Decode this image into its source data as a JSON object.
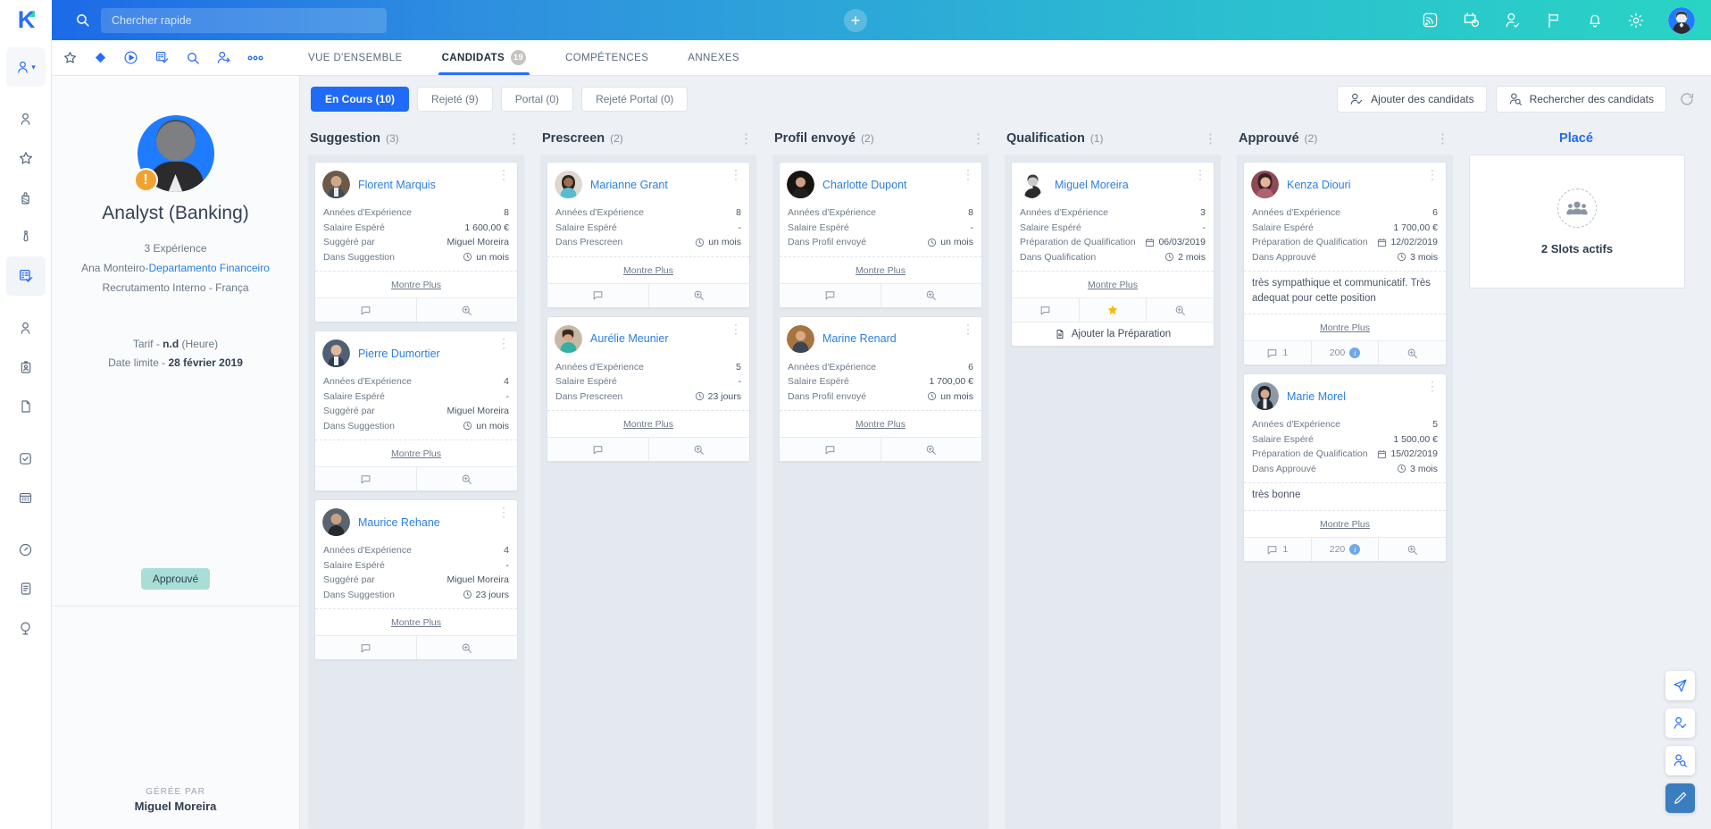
{
  "topbar": {
    "logo_text": "K",
    "search_placeholder": "Chercher rapide",
    "search_value": "",
    "add_label": "+",
    "icons": [
      "rss-feed-icon",
      "calendar-clock-icon",
      "person-add-icon",
      "flag-icon",
      "bell-icon",
      "gear-icon"
    ]
  },
  "rail": {
    "items": [
      {
        "name": "person-dropdown",
        "icon": "person-chevron-icon"
      },
      {
        "name": "person",
        "icon": "person-icon"
      },
      {
        "name": "favorites",
        "icon": "star-icon"
      },
      {
        "name": "briefcase",
        "icon": "briefcase-icon"
      },
      {
        "name": "tie",
        "icon": "tie-icon"
      },
      {
        "name": "jobs",
        "icon": "list-check-icon"
      },
      {
        "name": "contact",
        "icon": "person-outline-icon"
      },
      {
        "name": "badge",
        "icon": "id-badge-icon"
      },
      {
        "name": "documents",
        "icon": "document-icon"
      },
      {
        "name": "tasks",
        "icon": "check-square-icon"
      },
      {
        "name": "calendar",
        "icon": "calendar-grid-icon"
      },
      {
        "name": "reports",
        "icon": "gauge-icon"
      },
      {
        "name": "notes",
        "icon": "notes-icon"
      },
      {
        "name": "globe",
        "icon": "globe-icon"
      }
    ]
  },
  "tabbar": {
    "quick_icons": [
      "star-outline-icon",
      "diamond-icon",
      "play-circle-icon",
      "list-check-icon",
      "search-icon",
      "person-add-icon",
      "more-dots-icon"
    ],
    "tabs": [
      {
        "label": "VUE D'ENSEMBLE",
        "badge": "",
        "active": false
      },
      {
        "label": "CANDIDATS",
        "badge": "19",
        "active": true
      },
      {
        "label": "COMPÉTENCES",
        "badge": "",
        "active": false
      },
      {
        "label": "ANNEXES",
        "badge": "",
        "active": false
      }
    ]
  },
  "jobpanel": {
    "title": "Analyst (Banking)",
    "experience": "3 Expérience",
    "owner_prefix": "Ana Monteiro-",
    "department": "Departamento Financeiro",
    "recruitment": "Recrutamento Interno  -  França",
    "rate_label": "Tarif  -  ",
    "rate_value": "n.d",
    "rate_unit": "  (Heure)",
    "deadline_label": "Date limite  -  ",
    "deadline_value": "28 février 2019",
    "status": "Approuvé",
    "managed_by_label": "GÉRÉE PAR",
    "managed_by_name": "Miguel Moreira",
    "alert_icon": "warning-icon"
  },
  "toolbar": {
    "filters": [
      {
        "label": "En Cours (10)",
        "active": true
      },
      {
        "label": "Rejeté (9)",
        "active": false
      },
      {
        "label": "Portal (0)",
        "active": false
      },
      {
        "label": "Rejeté Portal (0)",
        "active": false
      }
    ],
    "add_candidates": "Ajouter des candidats",
    "search_candidates": "Rechercher des candidats",
    "refresh_icon": "refresh-icon"
  },
  "board": {
    "columns": [
      {
        "name": "Suggestion",
        "count": "(3)",
        "cards": [
          {
            "name": "Florent Marquis",
            "avatar_tone": "#6b5a4a",
            "rows": [
              {
                "label": "Années d'Expérience",
                "value": "8"
              },
              {
                "label": "Salaire Espéré",
                "value": "1 600,00 €"
              },
              {
                "label": "Suggéré par",
                "value": "Miguel Moreira"
              },
              {
                "label": "Dans Suggestion",
                "value": "un mois",
                "icon": "clock-icon"
              }
            ],
            "more": "Montre Plus",
            "actions": [
              "comment-icon",
              "zoom-search-icon"
            ]
          },
          {
            "name": "Pierre Dumortier",
            "avatar_tone": "#4f6074",
            "rows": [
              {
                "label": "Années d'Expérience",
                "value": "4"
              },
              {
                "label": "Salaire Espéré",
                "value": "-"
              },
              {
                "label": "Suggéré par",
                "value": "Miguel Moreira"
              },
              {
                "label": "Dans Suggestion",
                "value": "un mois",
                "icon": "clock-icon"
              }
            ],
            "more": "Montre Plus",
            "actions": [
              "comment-icon",
              "zoom-search-icon"
            ]
          },
          {
            "name": "Maurice Rehane",
            "avatar_tone": "#59646e",
            "rows": [
              {
                "label": "Années d'Expérience",
                "value": "4"
              },
              {
                "label": "Salaire Espéré",
                "value": "-"
              },
              {
                "label": "Suggéré par",
                "value": "Miguel Moreira"
              },
              {
                "label": "Dans Suggestion",
                "value": "23 jours",
                "icon": "clock-icon"
              }
            ],
            "more": "Montre Plus",
            "actions": [
              "comment-icon",
              "zoom-search-icon"
            ]
          }
        ]
      },
      {
        "name": "Prescreen",
        "count": "(2)",
        "cards": [
          {
            "name": "Marianne Grant",
            "avatar_tone": "#6d5143",
            "rows": [
              {
                "label": "Années d'Expérience",
                "value": "8"
              },
              {
                "label": "Salaire Espéré",
                "value": "-"
              },
              {
                "label": "Dans Prescreen",
                "value": "un mois",
                "icon": "clock-icon"
              }
            ],
            "more": "Montre Plus",
            "actions": [
              "comment-icon",
              "zoom-search-icon"
            ]
          },
          {
            "name": "Aurélie Meunier",
            "avatar_tone": "#3f9a9a",
            "rows": [
              {
                "label": "Années d'Expérience",
                "value": "5"
              },
              {
                "label": "Salaire Espéré",
                "value": "-"
              },
              {
                "label": "Dans Prescreen",
                "value": "23 jours",
                "icon": "clock-icon"
              }
            ],
            "more": "Montre Plus",
            "actions": [
              "comment-icon",
              "zoom-search-icon"
            ]
          }
        ]
      },
      {
        "name": "Profil envoyé",
        "count": "(2)",
        "cards": [
          {
            "name": "Charlotte Dupont",
            "avatar_tone": "#2f2a28",
            "rows": [
              {
                "label": "Années d'Expérience",
                "value": "8"
              },
              {
                "label": "Salaire Espéré",
                "value": "-"
              },
              {
                "label": "Dans Profil envoyé",
                "value": "un mois",
                "icon": "clock-icon"
              }
            ],
            "more": "Montre Plus",
            "actions": [
              "comment-icon",
              "zoom-search-icon"
            ]
          },
          {
            "name": "Marine Renard",
            "avatar_tone": "#8a6a48",
            "rows": [
              {
                "label": "Années d'Expérience",
                "value": "6"
              },
              {
                "label": "Salaire Espéré",
                "value": "1 700,00 €"
              },
              {
                "label": "Dans Profil envoyé",
                "value": "un mois",
                "icon": "clock-icon"
              }
            ],
            "more": "Montre Plus",
            "actions": [
              "comment-icon",
              "zoom-search-icon"
            ]
          }
        ]
      },
      {
        "name": "Qualification",
        "count": "(1)",
        "cards": [
          {
            "name": "Miguel Moreira",
            "avatar_tone": "#ffffff",
            "rows": [
              {
                "label": "Années d'Expérience",
                "value": "3"
              },
              {
                "label": "Salaire Espéré",
                "value": "-"
              },
              {
                "label": "Préparation de Qualification",
                "value": "06/03/2019",
                "icon": "calendar-icon"
              },
              {
                "label": "Dans Qualification",
                "value": "2 mois",
                "icon": "clock-icon"
              }
            ],
            "more": "Montre Plus",
            "actions": [
              "comment-icon",
              "star-icon",
              "zoom-search-icon"
            ],
            "footer_button": "Ajouter la Préparation",
            "footer_icon": "document-icon"
          }
        ]
      },
      {
        "name": "Approuvé",
        "count": "(2)",
        "cards": [
          {
            "name": "Kenza Diouri",
            "avatar_tone": "#a3606b",
            "rows": [
              {
                "label": "Années d'Expérience",
                "value": "6"
              },
              {
                "label": "Salaire Espéré",
                "value": "1 700,00 €"
              },
              {
                "label": "Préparation de Qualification",
                "value": "12/02/2019",
                "icon": "calendar-icon"
              },
              {
                "label": "Dans Approuvé",
                "value": "3 mois",
                "icon": "clock-icon"
              }
            ],
            "note": "très sympathique et communicatif. Très adequat pour cette position",
            "more": "Montre Plus",
            "comment_count": "1",
            "score": "200",
            "actions": [
              "comment-icon",
              "score-badge",
              "zoom-search-icon"
            ]
          },
          {
            "name": "Marie Morel",
            "avatar_tone": "#4a5c6e",
            "rows": [
              {
                "label": "Années d'Expérience",
                "value": "5"
              },
              {
                "label": "Salaire Espéré",
                "value": "1 500,00 €"
              },
              {
                "label": "Préparation de Qualification",
                "value": "15/02/2019",
                "icon": "calendar-icon"
              },
              {
                "label": "Dans Approuvé",
                "value": "3 mois",
                "icon": "clock-icon"
              }
            ],
            "note": "très bonne",
            "more": "Montre Plus",
            "comment_count": "1",
            "score": "220",
            "actions": [
              "comment-icon",
              "score-badge",
              "zoom-search-icon"
            ]
          }
        ]
      },
      {
        "name": "Placé",
        "count": "",
        "placed": true,
        "slots_text": "2 Slots actifs",
        "slots_icon": "people-group-icon"
      }
    ]
  },
  "fabs": [
    {
      "name": "send-icon"
    },
    {
      "name": "person-check-icon"
    },
    {
      "name": "person-search-icon"
    },
    {
      "name": "edit-pencil-icon",
      "primary": true
    }
  ],
  "colors": {
    "accent": "#1f6bf5",
    "link": "#2a7fe0",
    "status_bg": "#a9ded7",
    "board_bg": "#e4e9ef",
    "warning": "#f0a330",
    "star": "#f5b91b"
  }
}
